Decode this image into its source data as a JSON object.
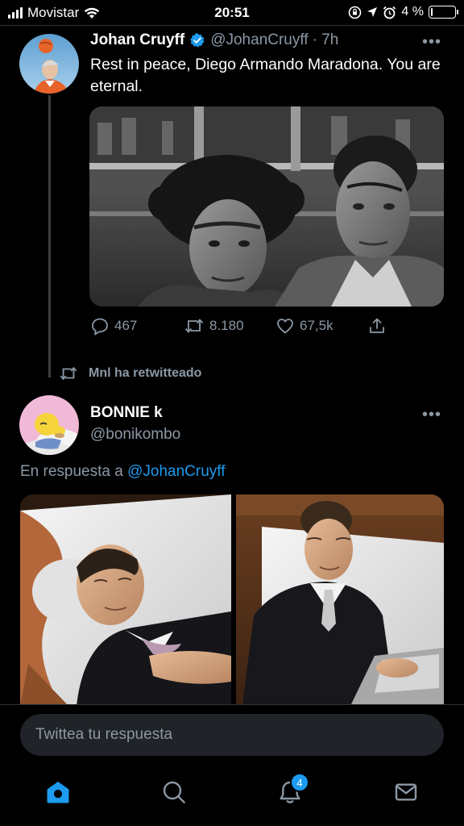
{
  "status_bar": {
    "carrier": "Movistar",
    "time": "20:51",
    "battery_percent": "4 %",
    "battery_level": 0.04
  },
  "tweet": {
    "author_name": "Johan Cruyff",
    "handle": "@JohanCruyff",
    "time_ago": "· 7h",
    "text": "Rest in peace, Diego Armando Maradona. You are eternal.",
    "more_label": "•••",
    "stats": {
      "replies": "467",
      "retweets": "8.180",
      "likes": "67,5k"
    }
  },
  "retweet_notice": "Mnl ha retwitteado",
  "reply": {
    "author_name": "BONNIE k",
    "handle": "@bonikombo",
    "more_label": "•••",
    "replying_prefix": "En respuesta a",
    "replying_mention": "@JohanCruyff"
  },
  "compose": {
    "placeholder": "Twittea tu respuesta"
  },
  "tab_bar": {
    "tabs": [
      "home-icon",
      "search-icon",
      "notifications-icon",
      "messages-icon"
    ],
    "notifications_count": "4"
  },
  "colors": {
    "accent": "#1d9bf0",
    "secondary_text": "#8b98a5",
    "background": "#000000"
  }
}
